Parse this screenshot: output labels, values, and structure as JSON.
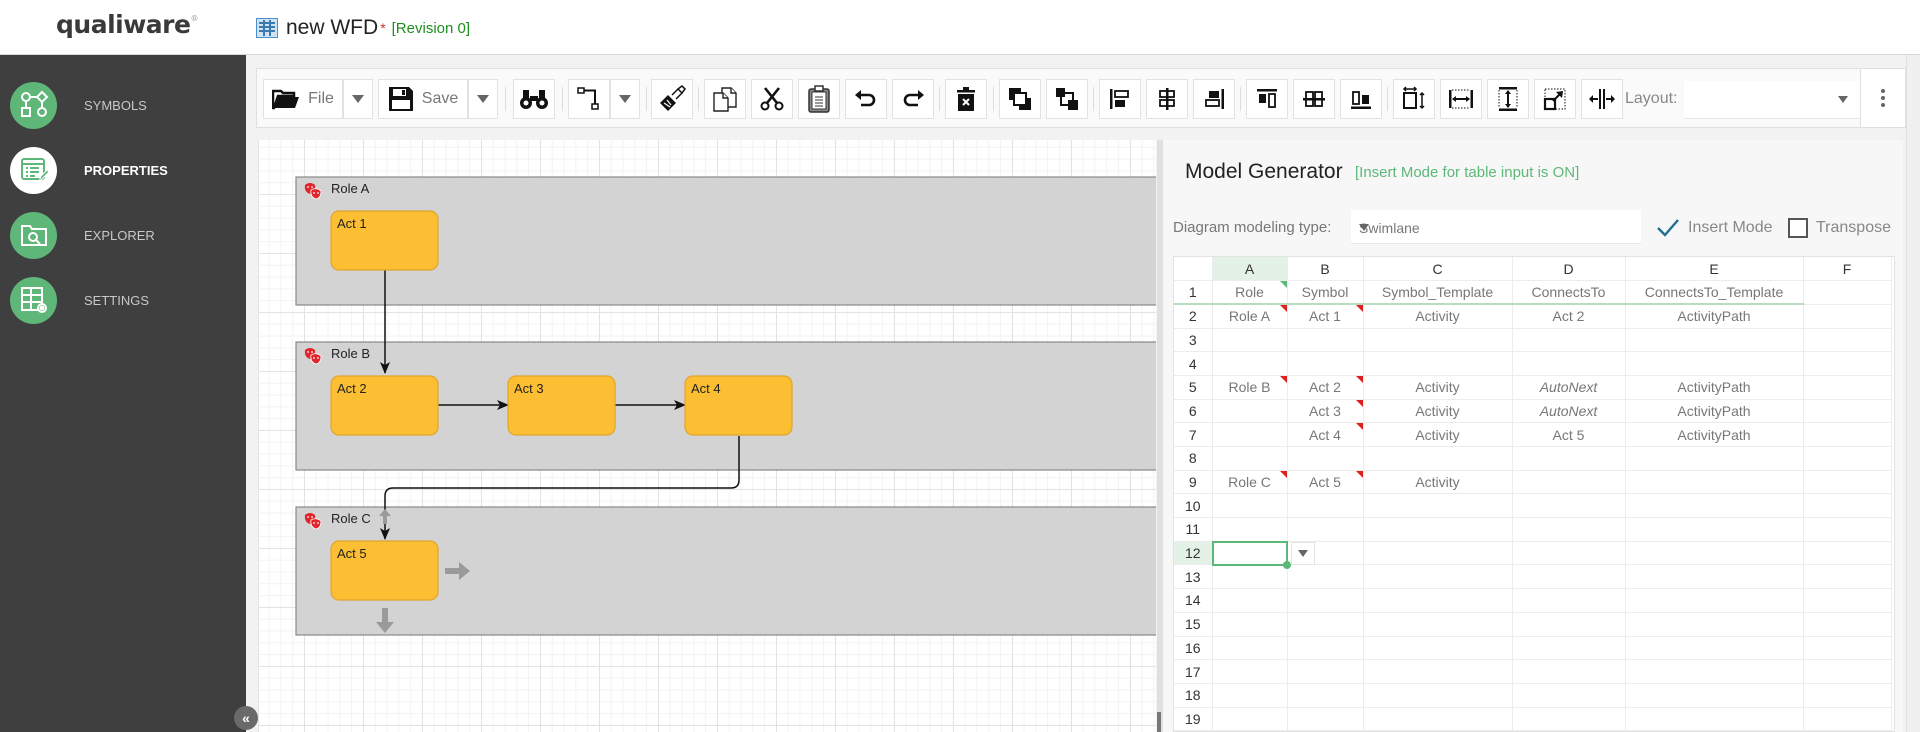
{
  "header": {
    "logo": "qualiware",
    "logo_mark": "®",
    "doc_title": "new WFD",
    "modified_marker": "*",
    "revision": "[Revision 0]"
  },
  "sidebar": {
    "items": [
      {
        "label": "SYMBOLS",
        "icon": "symbols-icon",
        "active": false
      },
      {
        "label": "PROPERTIES",
        "icon": "properties-icon",
        "active": true
      },
      {
        "label": "EXPLORER",
        "icon": "explorer-icon",
        "active": false
      },
      {
        "label": "SETTINGS",
        "icon": "settings-icon",
        "active": false
      }
    ],
    "collapse_glyph": "«"
  },
  "toolbar": {
    "file_label": "File",
    "save_label": "Save",
    "layout_label": "Layout:",
    "layout_value": "",
    "buttons": [
      "find",
      "connector",
      "format-painter",
      "copy",
      "cut",
      "paste",
      "undo",
      "redo",
      "delete",
      "bring-to-front",
      "send-to-back",
      "align-left",
      "align-center",
      "align-right",
      "align-top",
      "align-middle",
      "align-bottom",
      "same-size",
      "same-width",
      "same-height",
      "resize",
      "distribute"
    ]
  },
  "diagram": {
    "lanes": [
      {
        "name": "Role A"
      },
      {
        "name": "Role B"
      },
      {
        "name": "Role C"
      }
    ],
    "activities": [
      {
        "name": "Act 1",
        "lane": "Role A"
      },
      {
        "name": "Act 2",
        "lane": "Role B"
      },
      {
        "name": "Act 3",
        "lane": "Role B"
      },
      {
        "name": "Act 4",
        "lane": "Role B"
      },
      {
        "name": "Act 5",
        "lane": "Role C"
      }
    ],
    "connections": [
      {
        "from": "Act 1",
        "to": "Act 2"
      },
      {
        "from": "Act 2",
        "to": "Act 3"
      },
      {
        "from": "Act 3",
        "to": "Act 4"
      },
      {
        "from": "Act 4",
        "to": "Act 5"
      }
    ],
    "colors": {
      "activity_fill": "#fcbf33",
      "activity_border": "#e0a52b",
      "lane_fill": "#d3d3d3",
      "role_icon": "#e0252b"
    }
  },
  "panel": {
    "title": "Model Generator",
    "mode_note": "[Insert Mode for table input is ON]",
    "modeling_type_label": "Diagram modeling type:",
    "modeling_type_value": "Swimlane",
    "insert_mode_label": "Insert Mode",
    "insert_mode_checked": true,
    "transpose_label": "Transpose",
    "transpose_checked": false,
    "accent": "#5cb878"
  },
  "sheet": {
    "columns": [
      "A",
      "B",
      "C",
      "D",
      "E",
      "F"
    ],
    "active_column": "A",
    "active_row": 12,
    "rows": [
      {
        "n": "1",
        "cells": [
          "Role",
          "Symbol",
          "Symbol_Template",
          "ConnectsTo",
          "ConnectsTo_Template",
          ""
        ]
      },
      {
        "n": "2",
        "cells": [
          "Role A",
          "Act 1",
          "Activity",
          "Act 2",
          "ActivityPath",
          ""
        ]
      },
      {
        "n": "3",
        "cells": [
          "",
          "",
          "",
          "",
          "",
          ""
        ]
      },
      {
        "n": "4",
        "cells": [
          "",
          "",
          "",
          "",
          "",
          ""
        ]
      },
      {
        "n": "5",
        "cells": [
          "Role B",
          "Act 2",
          "Activity",
          "AutoNext",
          "ActivityPath",
          ""
        ]
      },
      {
        "n": "6",
        "cells": [
          "",
          "Act 3",
          "Activity",
          "AutoNext",
          "ActivityPath",
          ""
        ]
      },
      {
        "n": "7",
        "cells": [
          "",
          "Act 4",
          "Activity",
          "Act 5",
          "ActivityPath",
          ""
        ]
      },
      {
        "n": "8",
        "cells": [
          "",
          "",
          "",
          "",
          "",
          ""
        ]
      },
      {
        "n": "9",
        "cells": [
          "Role C",
          "Act 5",
          "Activity",
          "",
          "",
          ""
        ]
      },
      {
        "n": "10",
        "cells": [
          "",
          "",
          "",
          "",
          "",
          ""
        ]
      },
      {
        "n": "11",
        "cells": [
          "",
          "",
          "",
          "",
          "",
          ""
        ]
      },
      {
        "n": "12",
        "cells": [
          "",
          "",
          "",
          "",
          "",
          ""
        ]
      },
      {
        "n": "13",
        "cells": [
          "",
          "",
          "",
          "",
          "",
          ""
        ]
      },
      {
        "n": "14",
        "cells": [
          "",
          "",
          "",
          "",
          "",
          ""
        ]
      },
      {
        "n": "15",
        "cells": [
          "",
          "",
          "",
          "",
          "",
          ""
        ]
      },
      {
        "n": "16",
        "cells": [
          "",
          "",
          "",
          "",
          "",
          ""
        ]
      },
      {
        "n": "17",
        "cells": [
          "",
          "",
          "",
          "",
          "",
          ""
        ]
      },
      {
        "n": "18",
        "cells": [
          "",
          "",
          "",
          "",
          "",
          ""
        ]
      },
      {
        "n": "19",
        "cells": [
          "",
          "",
          "",
          "",
          "",
          ""
        ]
      }
    ]
  }
}
